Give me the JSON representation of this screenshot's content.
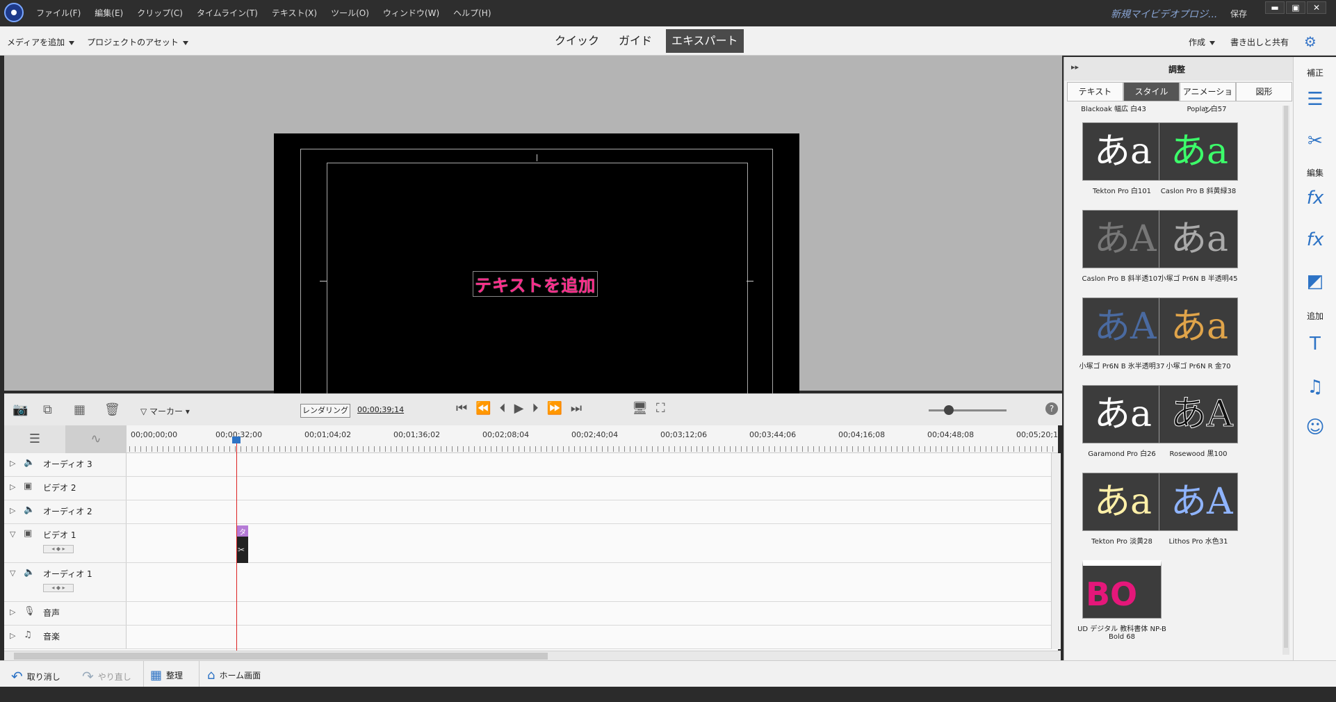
{
  "title": {
    "menus": [
      "ファイル(F)",
      "編集(E)",
      "クリップ(C)",
      "タイムライン(T)",
      "テキスト(X)",
      "ツール(O)",
      "ウィンドウ(W)",
      "ヘルプ(H)"
    ],
    "project_name": "新規マイビデオプロジ...",
    "save_label": "保存",
    "min": "▬",
    "max": "▣",
    "close": "✕"
  },
  "toolbar": {
    "add_media": "メディアを追加",
    "project_assets": "プロジェクトのアセット",
    "modes": [
      "クイック",
      "ガイド",
      "エキスパート"
    ],
    "active_mode": "エキスパート",
    "create": "作成",
    "export_share": "書き出しと共有"
  },
  "monitor": {
    "add_text": "テキストを追加"
  },
  "timeline": {
    "marker": "マーカー",
    "render": "レンダリング",
    "timecode": "00;00;39;14",
    "ruler": [
      "00;00;00;00",
      "00;00;32;00",
      "00;01;04;02",
      "00;01;36;02",
      "00;02;08;04",
      "00;02;40;04",
      "00;03;12;06",
      "00;03;44;06",
      "00;04;16;08",
      "00;04;48;08",
      "00;05;20;1"
    ],
    "tracks": [
      {
        "name": "オーディオ 3",
        "kind": "audio"
      },
      {
        "name": "ビデオ 2",
        "kind": "video"
      },
      {
        "name": "オーディオ 2",
        "kind": "audio"
      },
      {
        "name": "ビデオ 1",
        "kind": "video"
      },
      {
        "name": "オーディオ 1",
        "kind": "audio"
      },
      {
        "name": "音声",
        "kind": "voice"
      },
      {
        "name": "音楽",
        "kind": "music"
      }
    ],
    "clip_label": "タ"
  },
  "bottom": {
    "undo": "取り消し",
    "redo": "やり直し",
    "organize": "整理",
    "home": "ホーム画面"
  },
  "panel": {
    "title": "調整",
    "tabs": [
      "テキスト",
      "スタイル",
      "アニメーション",
      "図形"
    ],
    "active_tab": "スタイル",
    "top_captions": [
      "Blackoak 幅広 白43",
      "Poplar 白57"
    ],
    "styles": [
      {
        "caption": "Tekton Pro 白101",
        "glyph": "あa",
        "color": "#ffffff"
      },
      {
        "caption": "Caslon Pro B 斜黄緑38",
        "glyph": "あa",
        "color": "#3cff6a"
      },
      {
        "caption": "Caslon Pro B 斜半透107",
        "glyph": "あA",
        "color": "#777777"
      },
      {
        "caption": "小塚ゴ Pr6N B 半透明45",
        "glyph": "あa",
        "color": "#aaaaaa"
      },
      {
        "caption": "小塚ゴ Pr6N B 氷半透明37",
        "glyph": "あA",
        "color": "#4a6aa0"
      },
      {
        "caption": "小塚ゴ Pr6N R 金70",
        "glyph": "あa",
        "color": "#e0a44a"
      },
      {
        "caption": "Garamond Pro 白26",
        "glyph": "あa",
        "color": "#ffffff"
      },
      {
        "caption": "Rosewood 黒100",
        "glyph": "あA",
        "color": "#111111"
      },
      {
        "caption": "Tekton Pro 淡黄28",
        "glyph": "あa",
        "color": "#fff0a8"
      },
      {
        "caption": "Lithos Pro 水色31",
        "glyph": "あA",
        "color": "#8fb4ff"
      },
      {
        "caption": "UD デジタル 教科書体 NP-B Bold 68",
        "glyph": "BO",
        "color": "#e5177a"
      }
    ]
  },
  "sidebar": {
    "labels": [
      "補正",
      "編集",
      "追加"
    ]
  }
}
